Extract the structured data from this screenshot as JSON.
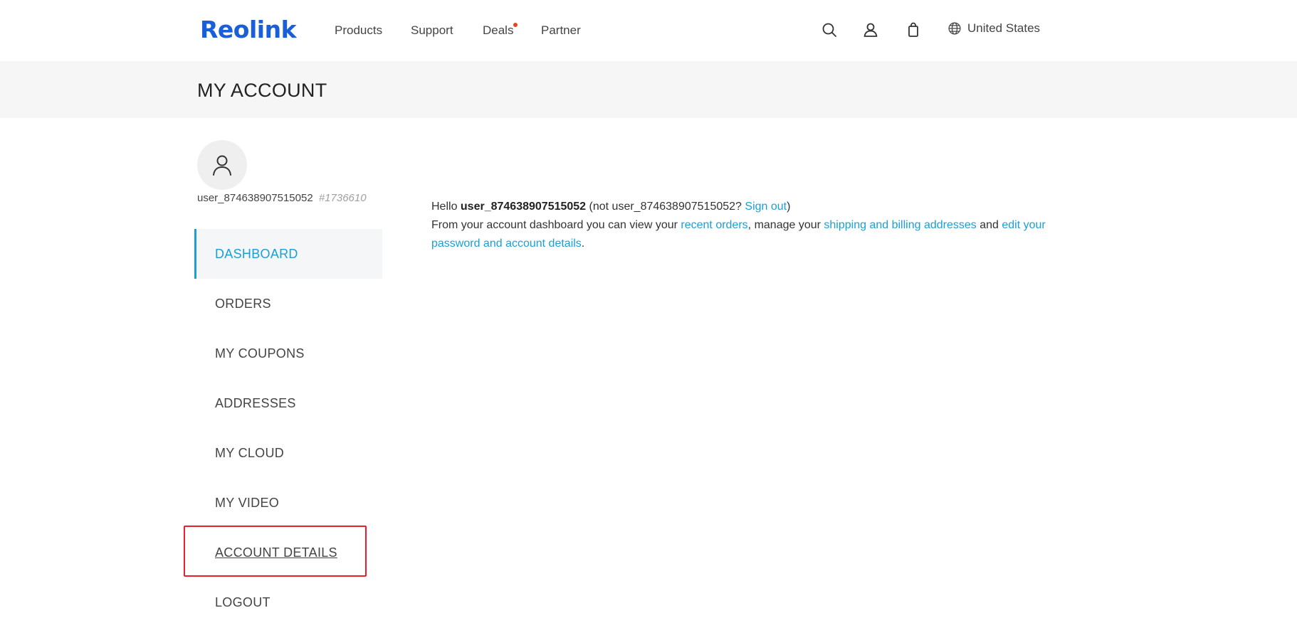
{
  "header": {
    "logo": "Reolink",
    "nav": {
      "products": "Products",
      "support": "Support",
      "deals": "Deals",
      "partner": "Partner"
    },
    "region": "United States",
    "icons": [
      "search-icon",
      "user-icon",
      "bag-icon",
      "globe-icon"
    ]
  },
  "page": {
    "title": "MY ACCOUNT"
  },
  "user": {
    "name": "user_874638907515052",
    "id": "#1736610"
  },
  "menu": {
    "dashboard": "DASHBOARD",
    "orders": "ORDERS",
    "coupons": "MY COUPONS",
    "addresses": "ADDRESSES",
    "cloud": "MY CLOUD",
    "video": "MY VIDEO",
    "account_details": "ACCOUNT DETAILS",
    "logout": "LOGOUT"
  },
  "dashboard": {
    "hello": "Hello ",
    "username": "user_874638907515052",
    "not_prefix": " (not user_874638907515052? ",
    "sign_out": "Sign out",
    "not_suffix": ")",
    "line2_start": "From your account dashboard you can view your ",
    "recent_orders": "recent orders",
    "line2_mid": ", manage your ",
    "addresses_link": "shipping and billing addresses",
    "line2_and": " and ",
    "edit_link": "edit your password and account details",
    "line2_end": "."
  },
  "colors": {
    "brand": "#1a5fd8",
    "accent": "#1a9fd6",
    "deals_dot": "#e5461b",
    "highlight": "#e8202a"
  }
}
